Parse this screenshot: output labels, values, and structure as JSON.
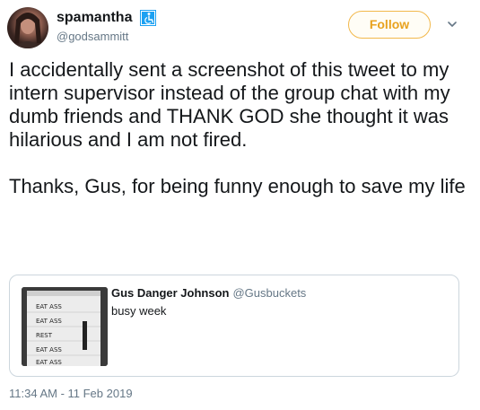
{
  "author": {
    "display_name": "spamantha",
    "handle": "@godsammitt",
    "badge_icon": "accessibility-badge-icon"
  },
  "follow_button": {
    "label": "Follow",
    "color": "#e8a21f"
  },
  "menu_icon": "chevron-down-icon",
  "tweet": {
    "text": "I accidentally sent a screenshot of this tweet to my intern supervisor instead of the group chat with my dumb friends and THANK GOD she thought it was hilarious and I am not fired.\n\nThanks, Gus, for being funny enough to save my life",
    "timestamp": "11:34 AM - 11 Feb 2019"
  },
  "quoted_tweet": {
    "author_name": "Gus Danger Johnson",
    "author_handle": "@Gusbuckets",
    "text": "busy week",
    "media_lines": [
      "EAT ASS",
      "EAT ASS",
      "REST",
      "EAT ASS",
      "EAT ASS"
    ]
  },
  "colors": {
    "text": "#14171a",
    "secondary": "#657786",
    "border": "#ccd6dd",
    "badge": "#1da1f2"
  }
}
